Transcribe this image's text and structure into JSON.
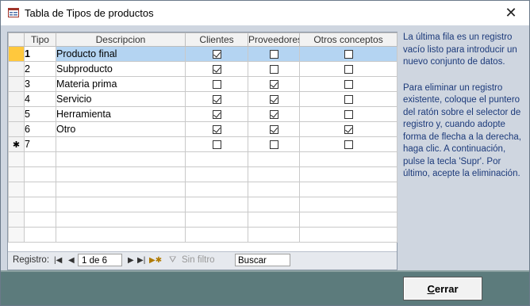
{
  "window": {
    "title": "Tabla de Tipos de productos"
  },
  "grid": {
    "columns": [
      "Tipo",
      "Descripcion",
      "Clientes",
      "Proveedores",
      "Otros conceptos"
    ],
    "rows": [
      {
        "tipo": "1",
        "descripcion": "Producto final",
        "clientes": true,
        "proveedores": false,
        "otros": false
      },
      {
        "tipo": "2",
        "descripcion": "Subproducto",
        "clientes": true,
        "proveedores": false,
        "otros": false
      },
      {
        "tipo": "3",
        "descripcion": "Materia prima",
        "clientes": false,
        "proveedores": true,
        "otros": false
      },
      {
        "tipo": "4",
        "descripcion": "Servicio",
        "clientes": true,
        "proveedores": true,
        "otros": false
      },
      {
        "tipo": "5",
        "descripcion": "Herramienta",
        "clientes": true,
        "proveedores": true,
        "otros": false
      },
      {
        "tipo": "6",
        "descripcion": "Otro",
        "clientes": true,
        "proveedores": true,
        "otros": true
      },
      {
        "tipo": "7",
        "descripcion": "",
        "clientes": false,
        "proveedores": false,
        "otros": false,
        "new": true
      }
    ]
  },
  "navigator": {
    "label": "Registro:",
    "record": "1 de 6",
    "filter": "Sin filtro",
    "search": "Buscar"
  },
  "help": {
    "p1": "La última fila es un registro vacío listo para introducir un nuevo conjunto de datos.",
    "p2": "Para eliminar un registro existente, coloque el puntero del ratón sobre el selector de registro y, cuando adopte forma de flecha a la derecha, haga clic. A continuación, pulse la tecla 'Supr'. Por último, acepte la eliminación."
  },
  "footer": {
    "close_label_first": "C",
    "close_label_rest": "errar"
  }
}
